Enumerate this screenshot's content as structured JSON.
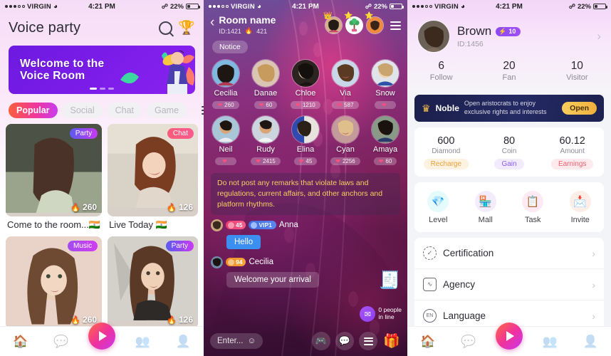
{
  "status_bar": {
    "carrier": "VIRGIN",
    "time": "4:21 PM",
    "battery": "22%",
    "wifi_icon": "wifi-icon",
    "bluetooth_icon": "bluetooth-icon"
  },
  "home": {
    "title": "Voice party",
    "search_icon": "search-icon",
    "trophy_icon": "trophy-icon",
    "banner": {
      "line1": "Welcome to the",
      "line2": "Voice Room"
    },
    "tabs": [
      {
        "label": "Popular",
        "active": true
      },
      {
        "label": "Social",
        "active": false
      },
      {
        "label": "Chat",
        "active": false
      },
      {
        "label": "Game",
        "active": false
      }
    ],
    "menu_icon": "hamburger-icon",
    "cards": [
      {
        "tag": "Party",
        "tag_type": "party",
        "hot": "260",
        "title": "Come to the room...🇮🇳"
      },
      {
        "tag": "Chat",
        "tag_type": "chat",
        "hot": "126",
        "title": "Live Today 🇮🇳"
      },
      {
        "tag": "Music",
        "tag_type": "music",
        "hot": "260",
        "title": ""
      },
      {
        "tag": "Party",
        "tag_type": "party",
        "hot": "126",
        "title": ""
      }
    ],
    "bottom_nav": [
      {
        "name": "home-icon",
        "glyph": "🏠",
        "active": true
      },
      {
        "name": "message-icon",
        "glyph": "💬",
        "active": false
      },
      {
        "name": "live-play-icon",
        "glyph": "▶",
        "active": true
      },
      {
        "name": "group-icon",
        "glyph": "👥",
        "active": false
      },
      {
        "name": "profile-icon",
        "glyph": "👤",
        "active": false
      }
    ]
  },
  "room": {
    "back_icon": "back-chevron-icon",
    "name": "Room name",
    "id": "ID:1421",
    "heat": "421",
    "heat_icon": "fire-icon",
    "menu_icon": "hamburger-icon",
    "header_avatars": [
      {
        "name": "host-avatar",
        "crown": true
      },
      {
        "name": "gift-tree-avatar",
        "crown": true
      },
      {
        "name": "guest-avatar",
        "crown": true
      }
    ],
    "notice_pill": "Notice",
    "seats_row1": [
      {
        "name": "Cecilia",
        "count": "260"
      },
      {
        "name": "Danae",
        "count": "60"
      },
      {
        "name": "Chloe",
        "count": "1210"
      },
      {
        "name": "Via",
        "count": "587"
      },
      {
        "name": "Snow",
        "count": ""
      }
    ],
    "seats_row2": [
      {
        "name": "Neil",
        "count": ""
      },
      {
        "name": "Rudy",
        "count": "2415"
      },
      {
        "name": "Elina",
        "count": "45"
      },
      {
        "name": "Cyan",
        "count": "2256"
      },
      {
        "name": "Amaya",
        "count": "60"
      }
    ],
    "notice_text": "Do not post any remarks that violate laws and regulations, current affairs, and other anchors and platform rhythms.",
    "messages": [
      {
        "level": "45",
        "vip": "VIP1",
        "user": "Anna",
        "text": "Hello",
        "bubble": "blue"
      },
      {
        "level": "94",
        "vip": "",
        "user": "Cecilia",
        "text": "Welcome your arrival",
        "bubble": "grey"
      }
    ],
    "chest_icon": "treasure-chest-icon",
    "in_line": {
      "count_text": "0 people",
      "label": "in line",
      "icon": "inbox-icon"
    },
    "input_placeholder": "Enter...",
    "emoji_icon": "emoji-icon",
    "actions": [
      {
        "name": "game-icon",
        "glyph": "🎮"
      },
      {
        "name": "chat-bubble-icon",
        "glyph": "💬"
      },
      {
        "name": "list-menu-icon",
        "glyph": ""
      },
      {
        "name": "gift-icon",
        "glyph": "🎁"
      }
    ]
  },
  "profile": {
    "user": {
      "name": "Brown",
      "level": "10",
      "level_icon": "level-badge-icon",
      "id": "ID:1456"
    },
    "chevron_icon": "chevron-right-icon",
    "stats": [
      {
        "num": "6",
        "label": "Follow"
      },
      {
        "num": "20",
        "label": "Fan"
      },
      {
        "num": "10",
        "label": "Visitor"
      }
    ],
    "noble": {
      "crown_icon": "crown-icon",
      "label": "Noble",
      "desc_line1": "Open aristocrats to enjoy",
      "desc_line2": "exclusive rights and interests",
      "button": "Open"
    },
    "wallet": [
      {
        "num": "600",
        "label": "Diamond",
        "action": "Recharge",
        "style": "w-recharge"
      },
      {
        "num": "80",
        "label": "Coin",
        "action": "Gain",
        "style": "w-gain"
      },
      {
        "num": "60.12",
        "label": "Amount",
        "action": "Earnings",
        "style": "w-earn"
      }
    ],
    "quick": [
      {
        "label": "Level",
        "icon": "level-icon",
        "glyph": "💎",
        "style": "q-level"
      },
      {
        "label": "Mall",
        "icon": "mall-icon",
        "glyph": "🏪",
        "style": "q-mall"
      },
      {
        "label": "Task",
        "icon": "task-icon",
        "glyph": "📋",
        "style": "q-task"
      },
      {
        "label": "Invite",
        "icon": "invite-icon",
        "glyph": "📩",
        "style": "q-inv"
      }
    ],
    "rows": [
      {
        "label": "Certification",
        "icon": "certification-badge-icon",
        "glyph": "✓"
      },
      {
        "label": "Agency",
        "icon": "agency-house-icon",
        "glyph": "∿"
      },
      {
        "label": "Language",
        "icon": "language-icon",
        "glyph": "EN"
      }
    ],
    "bottom_nav": [
      {
        "name": "home-icon",
        "glyph": "🏠",
        "active": true
      },
      {
        "name": "message-icon",
        "glyph": "💬",
        "active": false
      },
      {
        "name": "live-play-icon",
        "glyph": "▶",
        "active": true
      },
      {
        "name": "group-icon",
        "glyph": "👥",
        "active": false
      },
      {
        "name": "profile-icon",
        "glyph": "👤",
        "active": false
      }
    ]
  },
  "colors": {
    "accent_pink": "#f0379c",
    "accent_orange": "#fb5f3b",
    "banner_purple": "#7a1ce8",
    "noble_navy": "#1b1f4b",
    "noble_gold": "#f5c44a"
  }
}
